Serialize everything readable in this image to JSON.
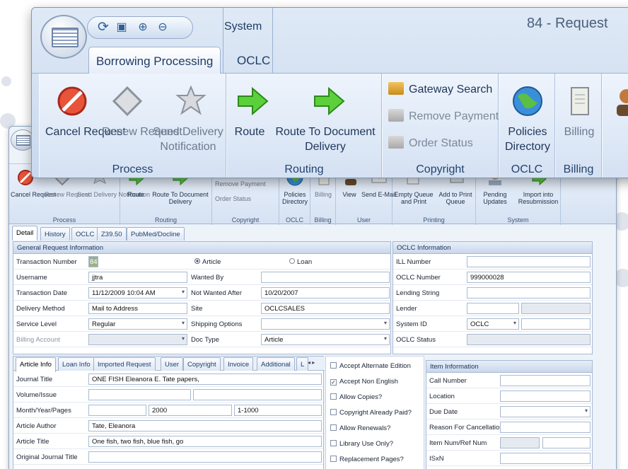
{
  "title": "84 - Request",
  "tabs_top": {
    "system": "System",
    "borrowing": "Borrowing Processing",
    "oclc": "OCLC"
  },
  "ribbon": {
    "process": {
      "label": "Process",
      "cancel": "Cancel Request",
      "renew": "Renew Request",
      "send": "Send Delivery Notification"
    },
    "routing": {
      "label": "Routing",
      "route": "Route",
      "route_doc": "Route To Document Delivery"
    },
    "copyright": {
      "label": "Copyright",
      "gateway": "Gateway Search",
      "remove": "Remove Payment",
      "order": "Order Status"
    },
    "oclc": {
      "label": "OCLC",
      "policies": "Policies Directory"
    },
    "billing": {
      "label": "Billing",
      "billing": "Billing"
    },
    "user": {
      "label": "User",
      "view": "View",
      "email": "Send E-Mail"
    },
    "printing": {
      "label": "Printing",
      "empty": "Empty Queue and Print",
      "add": "Add to Print Queue"
    },
    "system": {
      "label": "System",
      "pending": "Pending Updates",
      "import": "Import into Resubmission"
    }
  },
  "detail_tabs": [
    "Detail",
    "History",
    "OCLC",
    "Z39.50",
    "PubMed/Docline"
  ],
  "general": {
    "header": "General Request Information",
    "transaction_number_label": "Transaction Number",
    "transaction_number": "84",
    "article": "Article",
    "loan": "Loan",
    "username_label": "Username",
    "username": "jjtra",
    "wanted_by_label": "Wanted By",
    "wanted_by": "",
    "transaction_date_label": "Transaction Date",
    "transaction_date": "11/12/2009 10:04 AM",
    "not_wanted_label": "Not Wanted After",
    "not_wanted": "10/20/2007",
    "delivery_label": "Delivery Method",
    "delivery": "Mail to Address",
    "site_label": "Site",
    "site": "OCLCSALES",
    "service_label": "Service Level",
    "service": "Regular",
    "shipping_label": "Shipping Options",
    "shipping": "",
    "billing_label": "Billing Account",
    "billing": "",
    "doctype_label": "Doc Type",
    "doctype": "Article"
  },
  "oclc_info": {
    "header": "OCLC Information",
    "ill_label": "ILL Number",
    "ill": "",
    "oclc_number_label": "OCLC Number",
    "oclc_number": "999000028",
    "lending_label": "Lending String",
    "lending": "",
    "lender_label": "Lender",
    "lender": "",
    "system_id_label": "System ID",
    "system_id": "OCLC",
    "status_label": "OCLC Status",
    "status": ""
  },
  "article_tabs": [
    "Article Info",
    "Loan Info",
    "Imported Request",
    "User",
    "Copyright",
    "Invoice",
    "Additional",
    "L"
  ],
  "article": {
    "journal_title_label": "Journal Title",
    "journal_title": "ONE FISH Eleanora E. Tate papers,",
    "volume_label": "Volume/Issue",
    "volume": "",
    "issue": "",
    "myp_label": "Month/Year/Pages",
    "month": "",
    "year": "2000",
    "pages": "1-1000",
    "author_label": "Article Author",
    "author": "Tate, Eleanora",
    "article_title_label": "Article Title",
    "article_title": "One fish, two fish, blue fish, go",
    "orig_label": "Original Journal Title",
    "orig": ""
  },
  "checks": [
    {
      "label": "Accept Alternate Edition",
      "checked": false
    },
    {
      "label": "Accept Non English",
      "checked": true
    },
    {
      "label": "Allow Copies?",
      "checked": false
    },
    {
      "label": "Copyright Already Paid?",
      "checked": false
    },
    {
      "label": "Allow Renewals?",
      "checked": false
    },
    {
      "label": "Library Use Only?",
      "checked": false
    },
    {
      "label": "Replacement Pages?",
      "checked": false
    }
  ],
  "item_info": {
    "header": "Item Information",
    "call_label": "Call Number",
    "location_label": "Location",
    "due_label": "Due Date",
    "reason_label": "Reason For Cancellation",
    "itemnum_label": "Item Num/Ref Num",
    "isxn_label": "ISxN"
  }
}
